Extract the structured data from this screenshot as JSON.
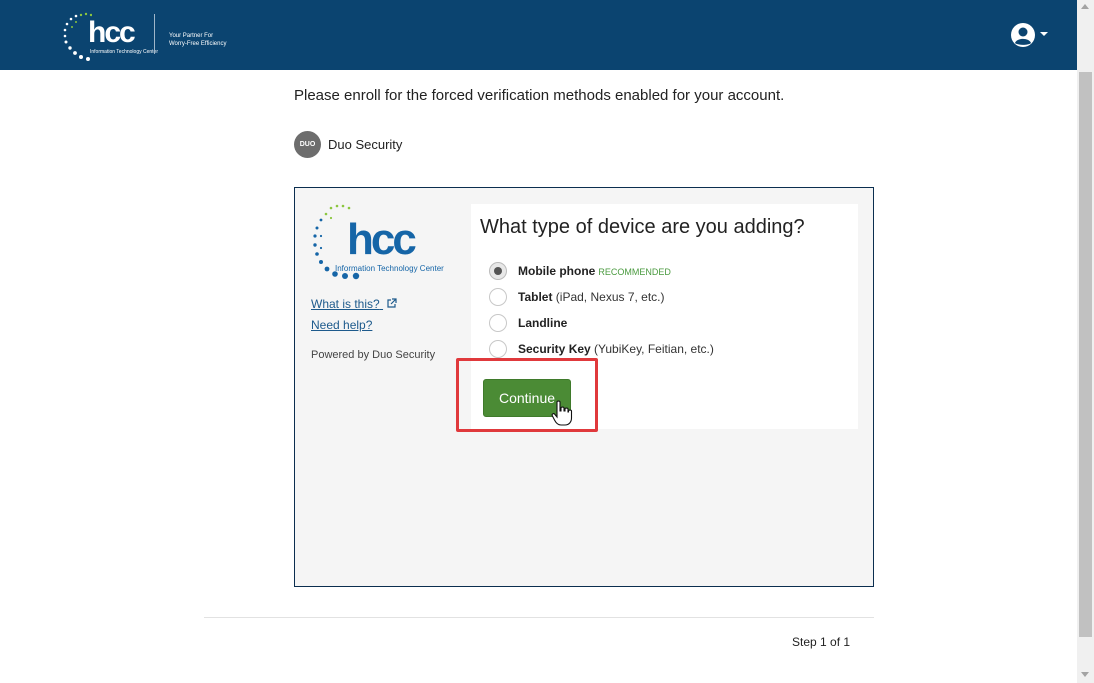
{
  "header": {
    "logo_word": "hcc",
    "logo_sub": "Information Technology Center",
    "tagline_line1": "Your Partner For",
    "tagline_line2": "Worry-Free Efficiency",
    "user_icon": "user-circle-icon"
  },
  "instructions": "Please enroll for the forced verification methods enabled for your account.",
  "duo": {
    "badge_text": "DUO",
    "label": "Duo Security"
  },
  "frame": {
    "logo_word": "hcc",
    "logo_sub": "Information Technology Center",
    "what_link": "What is this?",
    "help_link": "Need help?",
    "powered_by": "Powered by Duo Security",
    "question": "What type of device are you adding?",
    "options": [
      {
        "name": "Mobile phone",
        "detail": "",
        "badge": "RECOMMENDED",
        "checked": true
      },
      {
        "name": "Tablet",
        "detail": "(iPad, Nexus 7, etc.)",
        "badge": "",
        "checked": false
      },
      {
        "name": "Landline",
        "detail": "",
        "badge": "",
        "checked": false
      },
      {
        "name": "Security Key",
        "detail": "(YubiKey, Feitian, etc.)",
        "badge": "",
        "checked": false
      }
    ],
    "continue_label": "Continue"
  },
  "footer": {
    "step": "Step 1 of 1"
  },
  "colors": {
    "header_bg": "#0b4470",
    "button_green": "#4b8b35",
    "highlight_red": "#e0393c",
    "link_blue": "#1d5a8c"
  }
}
